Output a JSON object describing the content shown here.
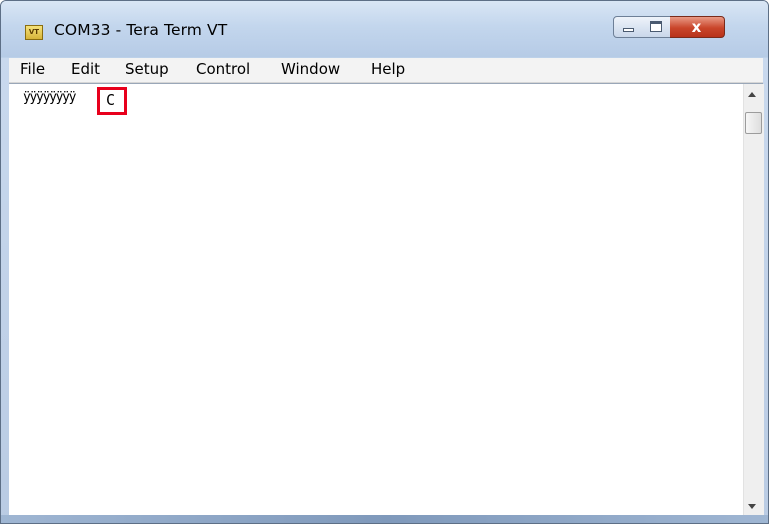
{
  "window": {
    "title": "COM33 - Tera Term VT",
    "icon": "VT",
    "close_glyph": "x"
  },
  "menu": {
    "items": [
      {
        "label": "File"
      },
      {
        "label": "Edit"
      },
      {
        "label": "Setup"
      },
      {
        "label": "Control"
      },
      {
        "label": "Window"
      },
      {
        "label": "Help"
      }
    ]
  },
  "terminal": {
    "output_text": "ÿÿÿÿÿÿÿÿ",
    "cursor_char": "C"
  },
  "colors": {
    "highlight": "#e8001c"
  },
  "icons": {
    "app": "tera-term-vt-icon",
    "minimize": "minimize-icon",
    "maximize": "maximize-icon",
    "close": "close-icon",
    "scroll_up": "arrow-up-icon",
    "scroll_down": "arrow-down-icon"
  }
}
